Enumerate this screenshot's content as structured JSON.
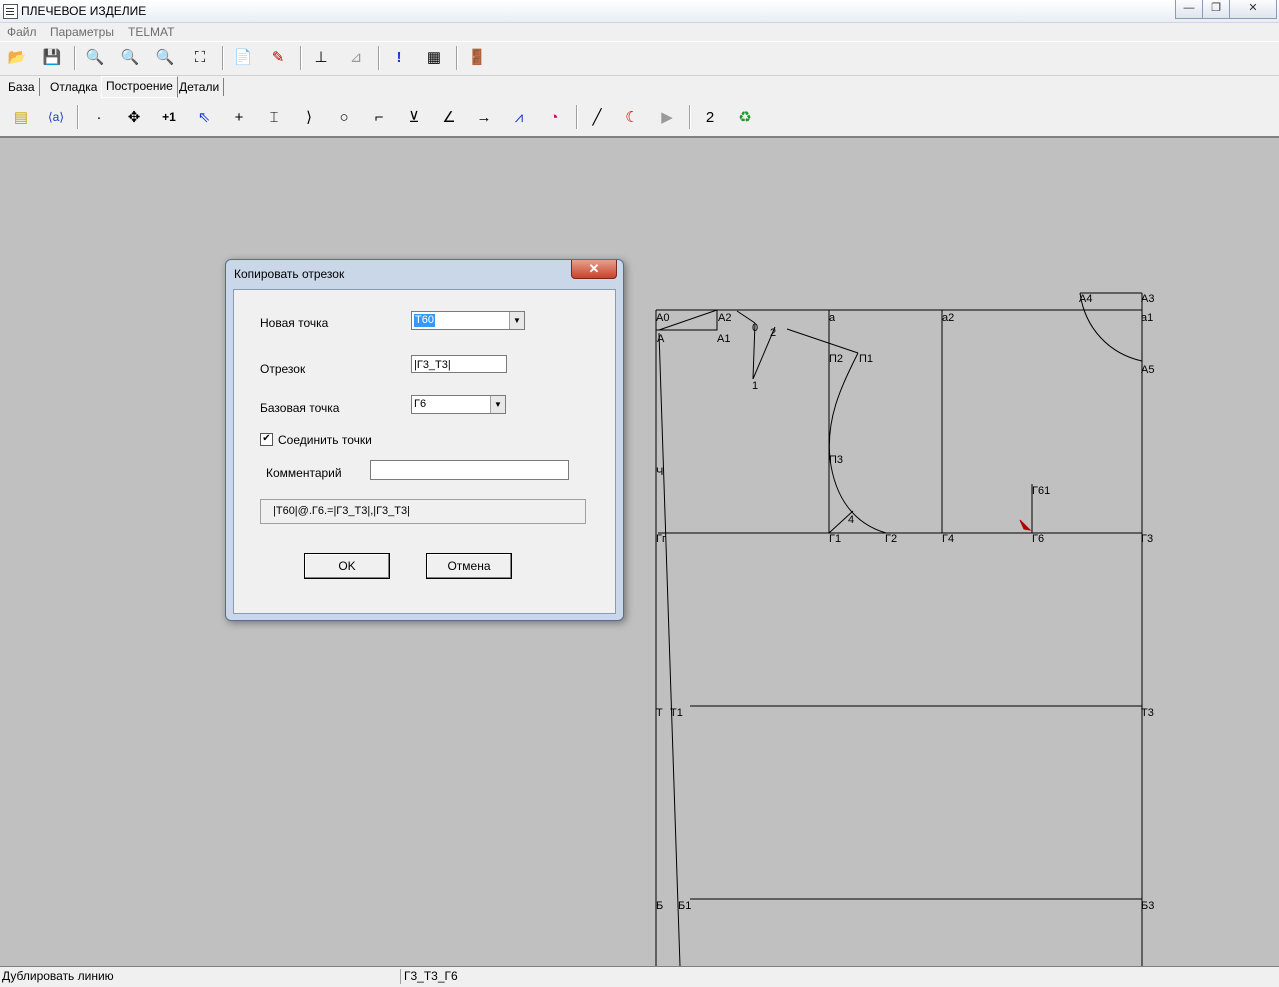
{
  "window": {
    "title": "ПЛЕЧЕВОЕ ИЗДЕЛИЕ"
  },
  "menu": [
    "Файл",
    "Параметры",
    "TELMAT"
  ],
  "tabs": [
    "База",
    "Отладка",
    "Построение",
    "Детали"
  ],
  "toolbar2_number": "2",
  "dialog": {
    "title": "Копировать отрезок",
    "close": "✕",
    "new_point_label": "Новая точка",
    "new_point_value": "Т60",
    "segment_label": "Отрезок",
    "segment_value": "|Г3_Т3|",
    "base_point_label": "Базовая точка",
    "base_point_value": "Г6",
    "connect_label": "Соединить точки",
    "comment_label": "Комментарий",
    "comment_value": "",
    "formula": "|Т60|@.Г6.=|Г3_Т3|,|Г3_Т3|",
    "ok": "OK",
    "cancel": "Отмена"
  },
  "drawing_labels": [
    "А0",
    "А2",
    "А",
    "А1",
    "0",
    "2",
    "1",
    "а",
    "а2",
    "А4",
    "А3",
    "а1",
    "А5",
    "П2",
    "П1",
    "П3",
    "Г61",
    "Ч",
    "4",
    "Гг",
    "Г1",
    "Г2",
    "Г4",
    "Г6",
    "Г3",
    "Т",
    "Т1",
    "Т3",
    "Б",
    "Б1",
    "Б3"
  ],
  "status": {
    "left": "Дублировать линию",
    "right": "Г3_Т3_Г6"
  }
}
